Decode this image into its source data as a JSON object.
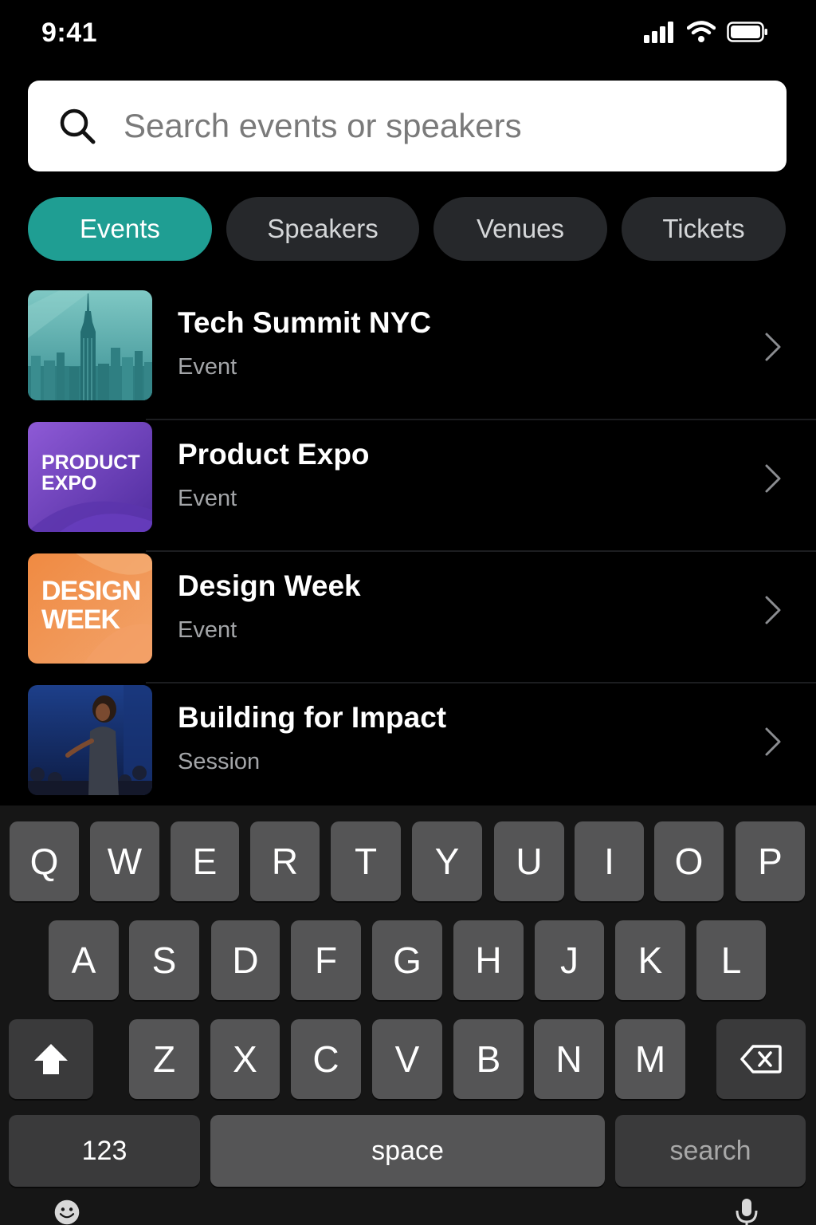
{
  "status": {
    "time": "9:41"
  },
  "search": {
    "placeholder": "Search events or speakers"
  },
  "tabs": [
    {
      "label": "Events",
      "active": true
    },
    {
      "label": "Speakers",
      "active": false
    },
    {
      "label": "Venues",
      "active": false
    },
    {
      "label": "Tickets",
      "active": false
    }
  ],
  "results": [
    {
      "title": "Tech Summit NYC",
      "type": "Event",
      "thumb": "city-skyline"
    },
    {
      "title": "Product Expo",
      "type": "Event",
      "thumb_text": [
        "PRODUCT",
        "EXPO"
      ],
      "thumb": "product-expo-tile"
    },
    {
      "title": "Design Week",
      "type": "Event",
      "thumb_text": [
        "DESIGN",
        "WEEK"
      ],
      "thumb": "design-week-tile"
    },
    {
      "title": "Building for Impact",
      "type": "Session",
      "thumb": "speaker-on-stage"
    }
  ],
  "keyboard": {
    "row1": [
      "Q",
      "W",
      "E",
      "R",
      "T",
      "Y",
      "U",
      "I",
      "O",
      "P"
    ],
    "row2": [
      "A",
      "S",
      "D",
      "F",
      "G",
      "H",
      "J",
      "K",
      "L"
    ],
    "row3": [
      "Z",
      "X",
      "C",
      "V",
      "B",
      "N",
      "M"
    ],
    "numbers_label": "123",
    "space_label": "space",
    "return_label": "search"
  },
  "colors": {
    "accent": "#1f9e93",
    "background": "#000000",
    "chip": "#26282b"
  }
}
